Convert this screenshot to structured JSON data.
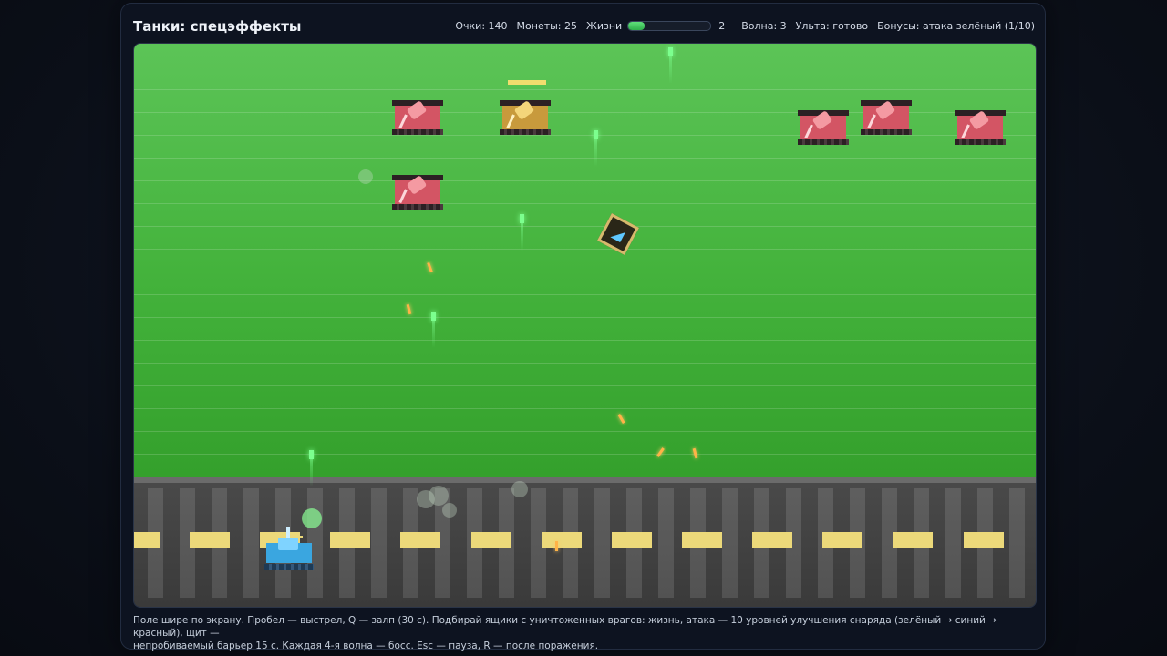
{
  "header": {
    "title": "Танки: спецэффекты"
  },
  "hud": {
    "score": "Очки: 140",
    "coins": "Монеты: 25",
    "lives_label": "Жизни",
    "lives_fill_fraction": 0.2,
    "lives_count": "2",
    "wave": "Волна: 3",
    "ultimate": "Ульта: готово",
    "bonuses": "Бонусы: атака зелёный (1/10)"
  },
  "colors": {
    "grass": "#43b23b",
    "road": "#3f3f3f",
    "road_dash": "#ecd97a",
    "enemy_tank": "#d35564",
    "boss_tank": "#c89a3c",
    "player_tank": "#3aa6e0",
    "player_bullet": "#7cff8e",
    "enemy_bullet": "#ffb347",
    "lives_fill": "#3fc65a"
  },
  "icons": {
    "crate": "triangle-arrow-icon"
  },
  "footer": {
    "line1": "Поле шире по экрану. Пробел — выстрел, Q — залп (30 с). Подбирай ящики с уничтоженных врагов: жизнь, атака — 10 уровней улучшения снаряда (зелёный → синий → красный), щит —",
    "line2": "непробиваемый барьер 15 с. Каждая 4-я волна — босс. Esc — пауза, R — после поражения."
  }
}
